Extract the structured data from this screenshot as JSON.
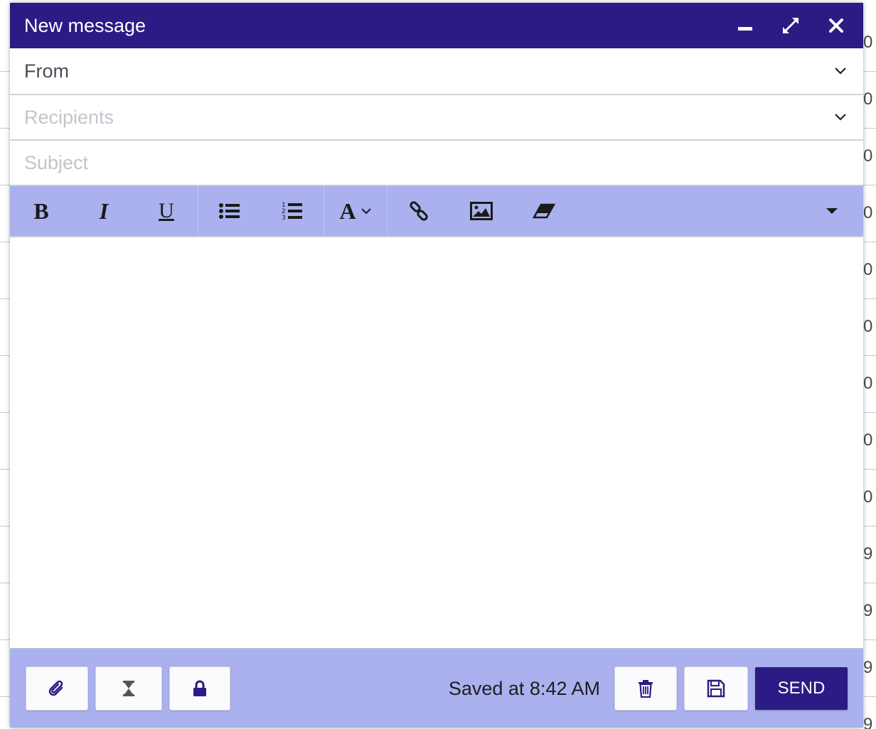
{
  "window": {
    "title": "New message",
    "minimize_icon": "minimize-icon",
    "maximize_icon": "expand-icon",
    "close_icon": "close-icon"
  },
  "fields": {
    "from_label": "From",
    "recipients_placeholder": "Recipients",
    "subject_placeholder": "Subject"
  },
  "toolbar": {
    "bold": "B",
    "italic": "I",
    "underline": "U",
    "font": "A",
    "icons": [
      "bold-icon",
      "italic-icon",
      "underline-icon",
      "bullet-list-icon",
      "numbered-list-icon",
      "font-icon",
      "link-icon",
      "image-icon",
      "eraser-icon",
      "more-caret-icon"
    ]
  },
  "footer": {
    "saved_text": "Saved at 8:42 AM",
    "send_label": "SEND",
    "icons": [
      "paperclip-icon",
      "hourglass-icon",
      "lock-icon",
      "trash-icon",
      "save-icon"
    ]
  },
  "background": {
    "digits": [
      "0",
      "0",
      "0",
      "0",
      "0",
      "0",
      "0",
      "0",
      "0",
      "9",
      "9",
      "9",
      "9"
    ]
  },
  "colors": {
    "accent": "#2c1a85",
    "toolbar_bg": "#aab1ee"
  }
}
